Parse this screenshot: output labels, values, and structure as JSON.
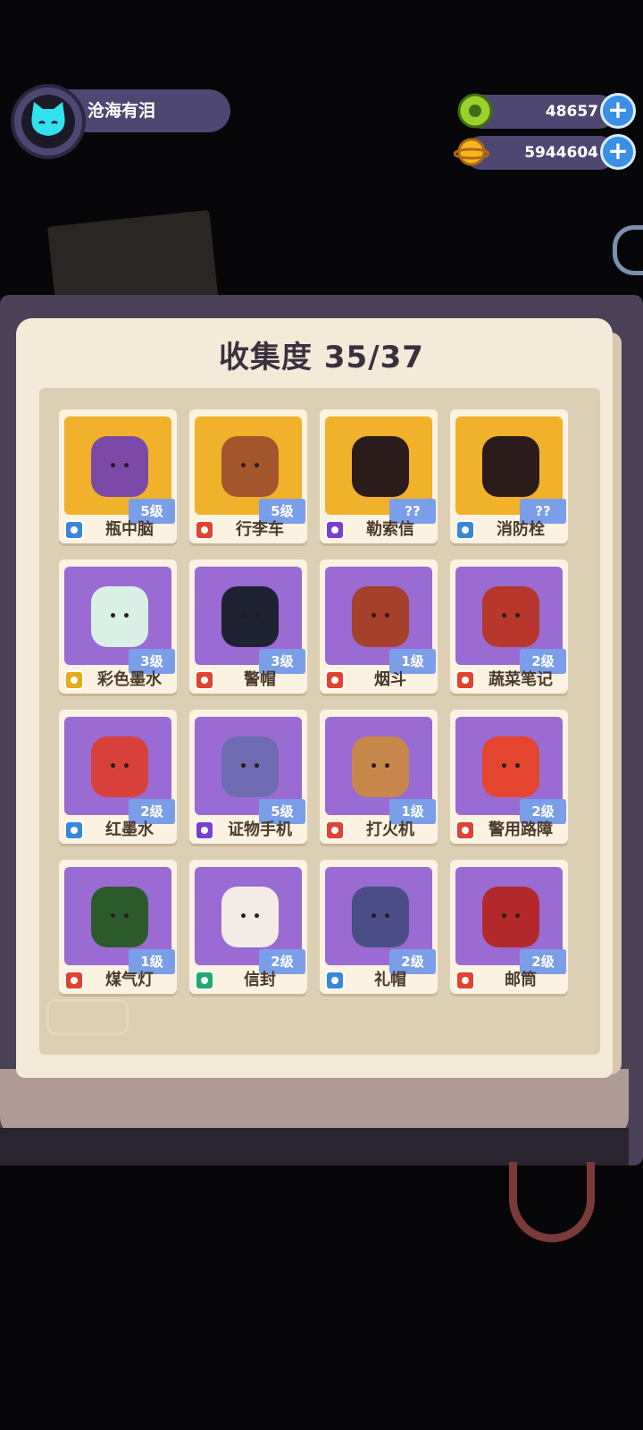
{
  "player": {
    "name": "沧海有泪",
    "avatar_icon": "cat-face-icon"
  },
  "currencies": [
    {
      "icon": "green-donut-coin-icon",
      "value": "48657",
      "plus_label": "+"
    },
    {
      "icon": "gold-planet-coin-icon",
      "value": "5944604",
      "plus_label": "+"
    }
  ],
  "collection": {
    "title_label": "收集度",
    "progress": "35/37"
  },
  "items": [
    {
      "name": "瓶中脑",
      "level": "5级",
      "type": "water",
      "bg": "gold",
      "color": "#7b4aa8"
    },
    {
      "name": "行李车",
      "level": "5级",
      "type": "fire",
      "bg": "gold",
      "color": "#a5552c"
    },
    {
      "name": "勒索信",
      "level": "??",
      "type": "moon",
      "bg": "gold",
      "color": "#2b1b1b"
    },
    {
      "name": "消防栓",
      "level": "??",
      "type": "water",
      "bg": "gold",
      "color": "#2b1b1b"
    },
    {
      "name": "彩色墨水",
      "level": "3级",
      "type": "gold",
      "bg": "purple",
      "color": "#d8f0e6"
    },
    {
      "name": "警帽",
      "level": "3级",
      "type": "fire",
      "bg": "purple",
      "color": "#1f2233"
    },
    {
      "name": "烟斗",
      "level": "1级",
      "type": "fire",
      "bg": "purple",
      "color": "#a5402a"
    },
    {
      "name": "蔬菜笔记",
      "level": "2级",
      "type": "fire",
      "bg": "purple",
      "color": "#b8372c"
    },
    {
      "name": "红墨水",
      "level": "2级",
      "type": "water",
      "bg": "purple",
      "color": "#d8413b"
    },
    {
      "name": "证物手机",
      "level": "5级",
      "type": "moon",
      "bg": "purple",
      "color": "#6e6bb3"
    },
    {
      "name": "打火机",
      "level": "1级",
      "type": "fire",
      "bg": "purple",
      "color": "#c8874a"
    },
    {
      "name": "警用路障",
      "level": "2级",
      "type": "fire",
      "bg": "purple",
      "color": "#e3452f"
    },
    {
      "name": "煤气灯",
      "level": "1级",
      "type": "fire",
      "bg": "purple",
      "color": "#2d5a2b"
    },
    {
      "name": "信封",
      "level": "2级",
      "type": "green",
      "bg": "purple",
      "color": "#f3ece6"
    },
    {
      "name": "礼帽",
      "level": "2级",
      "type": "water",
      "bg": "purple",
      "color": "#4b4e86"
    },
    {
      "name": "邮筒",
      "level": "2级",
      "type": "fire",
      "bg": "purple",
      "color": "#b3282a"
    }
  ]
}
